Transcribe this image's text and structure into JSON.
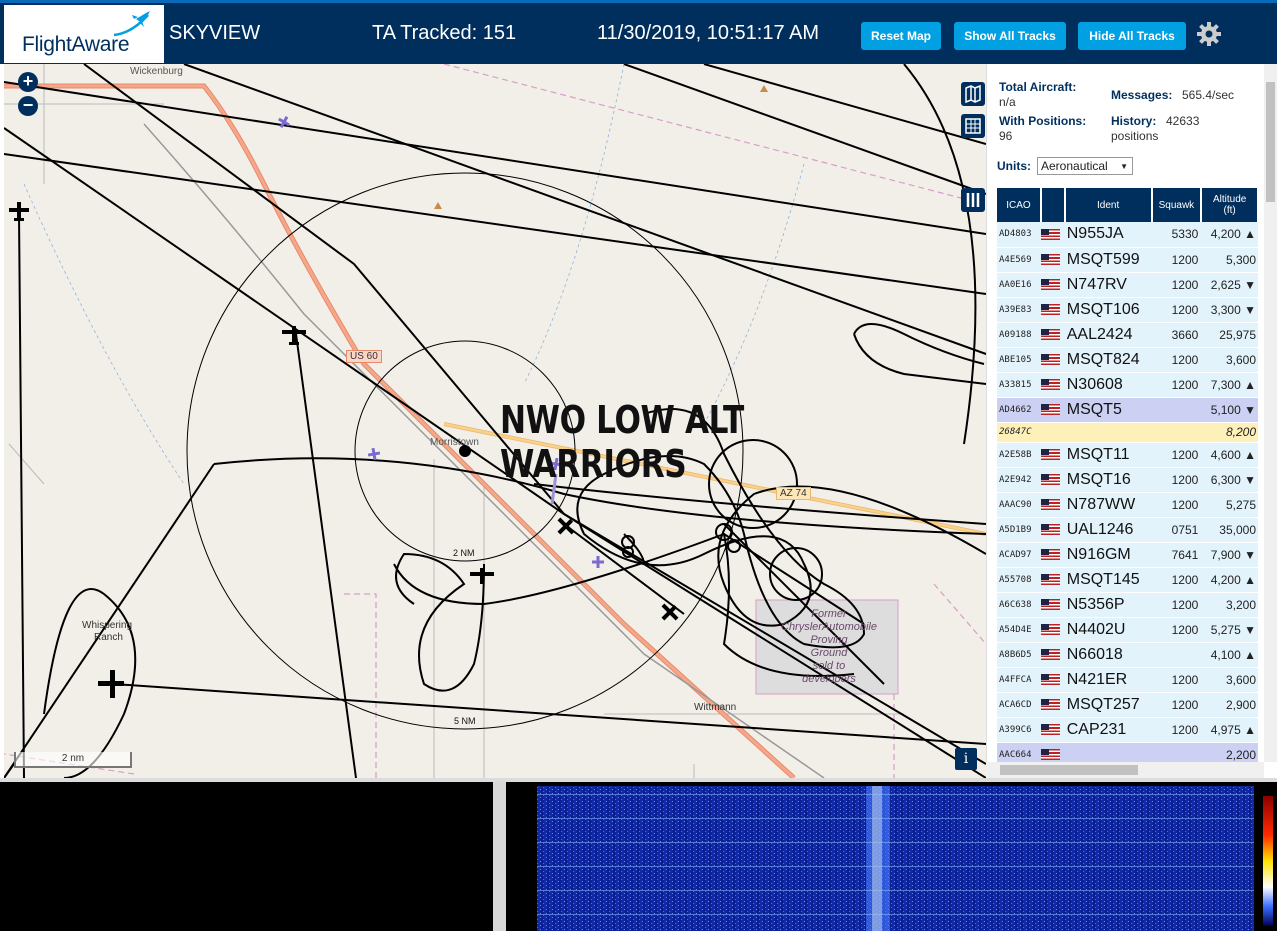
{
  "header": {
    "logo": "FlightAware",
    "title": "SKYVIEW",
    "tracked": "TA Tracked: 151",
    "datetime": "11/30/2019, 10:51:17 AM",
    "buttons": {
      "reset": "Reset Map",
      "show_all": "Show All Tracks",
      "hide_all": "Hide All Tracks"
    }
  },
  "map": {
    "overlay_text": "NWO LOW ALT WARRIORS",
    "labels": {
      "wickenburg": "Wickenburg",
      "us60": "US 60",
      "morristown": "Morristown",
      "az74": "AZ 74",
      "whispering": "Whispering",
      "ranch": "Ranch",
      "wittmann": "Wittmann",
      "ring_2nm": "2 NM",
      "ring_5nm": "5 NM",
      "proving_ground": [
        "Former",
        "ChryslerAutomobile",
        "Proving",
        "Ground",
        "sold to",
        "developers"
      ]
    },
    "scale": "2 nm",
    "info": "i"
  },
  "panel": {
    "total_aircraft_label": "Total Aircraft:",
    "total_aircraft_value": "n/a",
    "messages_label": "Messages:",
    "messages_value": "565.4/sec",
    "with_positions_label": "With Positions:",
    "with_positions_value": "96",
    "history_label": "History:",
    "history_value": "42633",
    "history_unit": "positions",
    "units_label": "Units:",
    "units_value": "Aeronautical",
    "columns": {
      "icao": "ICAO",
      "ident": "Ident",
      "squawk": "Squawk",
      "altitude": "Altitude",
      "altitude_unit": "(ft)"
    },
    "rows": [
      {
        "icao": "AD4803",
        "ident": "N955JA",
        "squawk": "5330",
        "alt": "4,200 ▲",
        "style": ""
      },
      {
        "icao": "A4E569",
        "ident": "MSQT599",
        "squawk": "1200",
        "alt": "5,300",
        "style": ""
      },
      {
        "icao": "AA0E16",
        "ident": "N747RV",
        "squawk": "1200",
        "alt": "2,625 ▼",
        "style": ""
      },
      {
        "icao": "A39E83",
        "ident": "MSQT106",
        "squawk": "1200",
        "alt": "3,300 ▼",
        "style": ""
      },
      {
        "icao": "A09188",
        "ident": "AAL2424",
        "squawk": "3660",
        "alt": "25,975",
        "style": ""
      },
      {
        "icao": "ABE105",
        "ident": "MSQT824",
        "squawk": "1200",
        "alt": "3,600",
        "style": ""
      },
      {
        "icao": "A33815",
        "ident": "N30608",
        "squawk": "1200",
        "alt": "7,300 ▲",
        "style": ""
      },
      {
        "icao": "AD4662",
        "ident": "MSQT5",
        "squawk": "",
        "alt": "5,100 ▼",
        "style": "sel"
      },
      {
        "icao": "26847C",
        "ident": "",
        "squawk": "",
        "alt": "8,200",
        "style": "yel"
      },
      {
        "icao": "A2E58B",
        "ident": "MSQT11",
        "squawk": "1200",
        "alt": "4,600 ▲",
        "style": ""
      },
      {
        "icao": "A2E942",
        "ident": "MSQT16",
        "squawk": "1200",
        "alt": "6,300 ▼",
        "style": ""
      },
      {
        "icao": "AAAC90",
        "ident": "N787WW",
        "squawk": "1200",
        "alt": "5,275",
        "style": ""
      },
      {
        "icao": "A5D1B9",
        "ident": "UAL1246",
        "squawk": "0751",
        "alt": "35,000",
        "style": ""
      },
      {
        "icao": "ACAD97",
        "ident": "N916GM",
        "squawk": "7641",
        "alt": "7,900 ▼",
        "style": ""
      },
      {
        "icao": "A55708",
        "ident": "MSQT145",
        "squawk": "1200",
        "alt": "4,200 ▲",
        "style": ""
      },
      {
        "icao": "A6C638",
        "ident": "N5356P",
        "squawk": "1200",
        "alt": "3,200",
        "style": ""
      },
      {
        "icao": "A54D4E",
        "ident": "N4402U",
        "squawk": "1200",
        "alt": "5,275 ▼",
        "style": ""
      },
      {
        "icao": "A8B6D5",
        "ident": "N66018",
        "squawk": "",
        "alt": "4,100 ▲",
        "style": ""
      },
      {
        "icao": "A4FFCA",
        "ident": "N421ER",
        "squawk": "1200",
        "alt": "3,600",
        "style": ""
      },
      {
        "icao": "ACA6CD",
        "ident": "MSQT257",
        "squawk": "1200",
        "alt": "2,900",
        "style": ""
      },
      {
        "icao": "A399C6",
        "ident": "CAP231",
        "squawk": "1200",
        "alt": "4,975 ▲",
        "style": ""
      },
      {
        "icao": "AAC664",
        "ident": "",
        "squawk": "",
        "alt": "2,200",
        "style": "sel"
      }
    ]
  }
}
